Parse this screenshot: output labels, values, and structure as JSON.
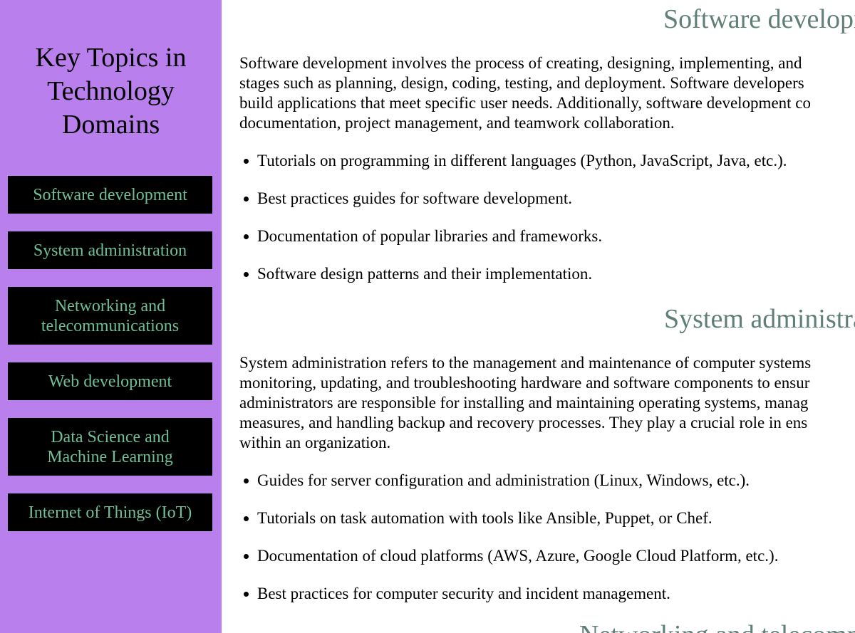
{
  "sidebar": {
    "title_lines": [
      "Key Topics in",
      "Technology",
      "Domains"
    ],
    "nav_items": [
      {
        "lines": [
          "Software development"
        ]
      },
      {
        "lines": [
          "System administration"
        ]
      },
      {
        "lines": [
          "Networking and",
          "telecommunications"
        ]
      },
      {
        "lines": [
          "Web development"
        ]
      },
      {
        "lines": [
          "Data Science and",
          "Machine Learning"
        ]
      },
      {
        "lines": [
          "Internet of Things (IoT)"
        ]
      }
    ]
  },
  "main": {
    "sections": [
      {
        "heading": "Software development",
        "paragraph_lines": [
          "Software development involves the process of creating, designing, implementing, and",
          "stages such as planning, design, coding, testing, and deployment. Software developers",
          "build applications that meet specific user needs. Additionally, software development co",
          "documentation, project management, and teamwork collaboration."
        ],
        "bullets": [
          "Tutorials on programming in different languages (Python, JavaScript, Java, etc.).",
          "Best practices guides for software development.",
          "Documentation of popular libraries and frameworks.",
          "Software design patterns and their implementation."
        ]
      },
      {
        "heading": "System administration",
        "paragraph_lines": [
          "System administration refers to the management and maintenance of computer systems",
          "monitoring, updating, and troubleshooting hardware and software components to ensur",
          "administrators are responsible for installing and maintaining operating systems, manag",
          "measures, and handling backup and recovery processes. They play a crucial role in ens",
          "within an organization."
        ],
        "bullets": [
          "Guides for server configuration and administration (Linux, Windows, etc.).",
          "Tutorials on task automation with tools like Ansible, Puppet, or Chef.",
          "Documentation of cloud platforms (AWS, Azure, Google Cloud Platform, etc.).",
          "Best practices for computer security and incident management."
        ]
      },
      {
        "heading": "Networking and telecommunications"
      }
    ]
  },
  "colors": {
    "sidebar_bg": "#b87fed",
    "nav_bg": "#000000",
    "nav_text": "#6fbf96",
    "heading_text": "#5f7f78",
    "body_text": "#000000"
  }
}
